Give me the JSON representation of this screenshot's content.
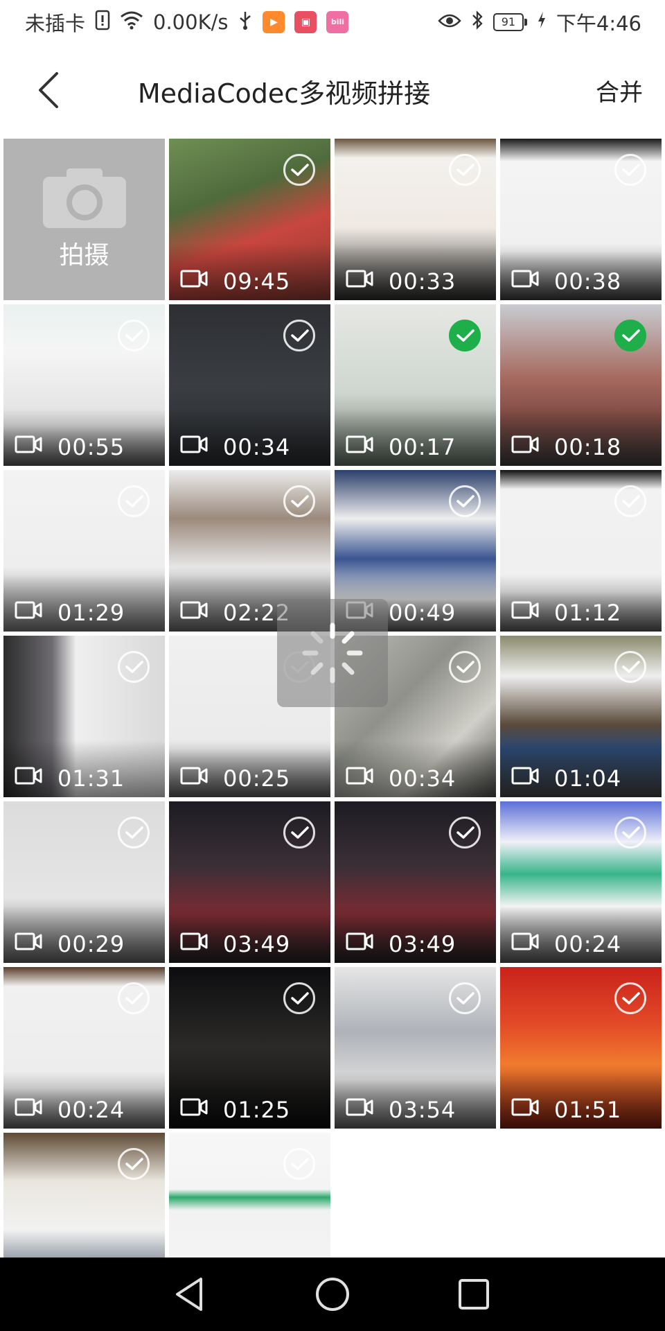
{
  "status_bar": {
    "carrier": "未插卡",
    "speed": "0.00K/s",
    "battery": "91",
    "time": "下午4:46",
    "app_icons": [
      {
        "name": "app-icon-orange",
        "color": "#ff8a2b",
        "glyph": "▶"
      },
      {
        "name": "app-icon-red",
        "color": "#e94e63",
        "glyph": "▣"
      },
      {
        "name": "app-icon-pink",
        "color": "#f06fa2",
        "glyph": "bili"
      }
    ]
  },
  "header": {
    "title": "MediaCodec多视频拼接",
    "merge_label": "合并"
  },
  "camera_tile": {
    "label": "拍摄"
  },
  "videos": [
    {
      "duration": "09:45",
      "checked": false,
      "bg": "linear-gradient(160deg,#6f8f55 0%,#4f6b3c 35%,#c8463e 60%,#8a3b32 100%)"
    },
    {
      "duration": "00:33",
      "checked": false,
      "bg": "linear-gradient(180deg,#6a5640 0%,#f3f1ee 12%,#efe9e2 55%,#2a2a2a 100%)"
    },
    {
      "duration": "00:38",
      "checked": false,
      "bg": "linear-gradient(180deg,#1a1a1a 0%,#f4f4f4 14%,#f0f0f0 70%,#3a3a3a 100%)"
    },
    {
      "duration": "00:55",
      "checked": false,
      "bg": "linear-gradient(180deg,#e9f2f0 0%,#f5f5f5 30%,#e0e0e0 75%,#555 100%)"
    },
    {
      "duration": "00:34",
      "checked": false,
      "bg": "linear-gradient(180deg,#2d2f33 0%,#3a3d42 50%,#27292c 100%)"
    },
    {
      "duration": "00:17",
      "checked": true,
      "bg": "linear-gradient(180deg,#e6e8e4 0%,#cfd6cf 55%,#5e6a5f 100%)"
    },
    {
      "duration": "00:18",
      "checked": true,
      "bg": "linear-gradient(180deg,#c8ccd2 0%,#a76b60 45%,#7e4a44 70%,#3c3c3c 100%)"
    },
    {
      "duration": "01:29",
      "checked": false,
      "bg": "linear-gradient(180deg,#f3f3f3 0%,#eeeeee 60%,#777 100%)"
    },
    {
      "duration": "02:22",
      "checked": false,
      "bg": "linear-gradient(180deg,#ececec 0%,#9b8a7c 30%,#e6e6e6 60%,#666 100%)"
    },
    {
      "duration": "00:49",
      "checked": false,
      "bg": "linear-gradient(180deg,#2b3f6b 0%,#eeeeee 30%,#3a5591 55%,#e6e6e6 80%,#555 100%)"
    },
    {
      "duration": "01:12",
      "checked": false,
      "bg": "linear-gradient(180deg,#111 0%,#f2f2f2 12%,#efefef 75%,#555 100%)"
    },
    {
      "duration": "01:31",
      "checked": false,
      "bg": "linear-gradient(90deg,#2b2b2b 0%,#6d6a70 30%,#efefef 45%,#d9d9d9 100%)"
    },
    {
      "duration": "00:25",
      "checked": false,
      "bg": "linear-gradient(180deg,#f0f0f0 0%,#eaeaea 70%,#5a5a5a 100%)"
    },
    {
      "duration": "00:34",
      "checked": false,
      "bg": "linear-gradient(135deg,#bdbdb7 0%,#8f918a 40%,#d0cfc8 70%,#4b4b48 100%)"
    },
    {
      "duration": "01:04",
      "checked": false,
      "bg": "linear-gradient(180deg,#8a8a6d 0%,#efefef 25%,#5a4a3a 55%,#2c4a75 70%,#444 100%)"
    },
    {
      "duration": "00:29",
      "checked": false,
      "bg": "linear-gradient(180deg,#dcdcdc 0%,#e5e5e5 60%,#5f5f5f 100%)"
    },
    {
      "duration": "03:49",
      "checked": false,
      "bg": "linear-gradient(180deg,#1c1c22 0%,#3b2f36 40%,#7b2b33 70%,#222 100%)"
    },
    {
      "duration": "03:49",
      "checked": false,
      "bg": "linear-gradient(180deg,#1c1c22 0%,#3b2f36 40%,#7b2b33 70%,#222 100%)"
    },
    {
      "duration": "00:24",
      "checked": false,
      "bg": "linear-gradient(180deg,#5b6fd6 0%,#f0f0f8 25%,#38b58a 45%,#f3f3f3 65%,#555 100%)"
    },
    {
      "duration": "00:24",
      "checked": false,
      "bg": "linear-gradient(180deg,#5a3d2a 0%,#f1f1f1 12%,#ececec 75%,#5b5b5b 100%)"
    },
    {
      "duration": "01:25",
      "checked": false,
      "bg": "linear-gradient(180deg,#0d0d10 0%,#2c2a28 50%,#0b0b0b 100%)"
    },
    {
      "duration": "03:54",
      "checked": false,
      "bg": "linear-gradient(180deg,#e6e6e6 0%,#aeb2b8 40%,#d9d9d9 70%,#5d5d5d 100%)"
    },
    {
      "duration": "01:51",
      "checked": false,
      "bg": "linear-gradient(180deg,#c9221b 0%,#e24a27 35%,#f07a2e 60%,#7a1d12 100%)"
    },
    {
      "duration": "",
      "checked": false,
      "bg": "linear-gradient(180deg,#5e4a35 0%,#eae6de 30%,#f2f2f2 60%,#2f3e54 100%)"
    },
    {
      "duration": "",
      "checked": false,
      "bg": "linear-gradient(180deg,#f7f7f7 0%,#f4f4f4 35%,#2fa96e 40%,#f2f2f2 48%,#f4f4f4 100%)"
    }
  ]
}
